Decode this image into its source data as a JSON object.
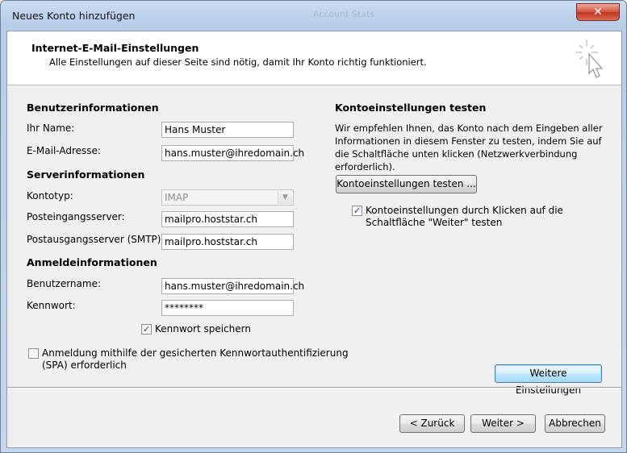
{
  "window": {
    "title": "Neues Konto hinzufügen",
    "background_title": "Account Stats",
    "close_label": "✕"
  },
  "header": {
    "title": "Internet-E-Mail-Einstellungen",
    "subtitle": "Alle Einstellungen auf dieser Seite sind nötig, damit Ihr Konto richtig funktioniert."
  },
  "user_info": {
    "heading": "Benutzerinformationen",
    "name_label": "Ihr Name:",
    "name_value": "Hans Muster",
    "email_label": "E-Mail-Adresse:",
    "email_value": "hans.muster@ihredomain.ch"
  },
  "server_info": {
    "heading": "Serverinformationen",
    "account_type_label": "Kontotyp:",
    "account_type_value": "IMAP",
    "incoming_label": "Posteingangsserver:",
    "incoming_value": "mailpro.hoststar.ch",
    "outgoing_label": "Postausgangsserver (SMTP):",
    "outgoing_value": "mailpro.hoststar.ch"
  },
  "login_info": {
    "heading": "Anmeldeinformationen",
    "username_label": "Benutzername:",
    "username_value": "hans.muster@ihredomain.ch",
    "password_label": "Kennwort:",
    "password_value": "********",
    "remember_label": "Kennwort speichern",
    "remember_checked": true,
    "spa_label_line1": "Anmeldung mithilfe der gesicherten Kennwortauthentifizierung",
    "spa_label_line2": "(SPA) erforderlich",
    "spa_checked": false
  },
  "test_settings": {
    "heading": "Kontoeinstellungen testen",
    "description": "Wir empfehlen Ihnen, das Konto nach dem Eingeben aller Informationen in diesem Fenster zu testen, indem Sie auf die Schaltfläche unten klicken (Netzwerkverbindung erforderlich).",
    "test_button": "Kontoeinstellungen testen ...",
    "auto_test_line1": "Kontoeinstellungen durch Klicken auf die",
    "auto_test_line2": "Schaltfläche \"Weiter\" testen",
    "auto_test_checked": true
  },
  "more_settings_button": "Weitere Einstellungen",
  "footer": {
    "back": "< Zurück",
    "next": "Weiter >",
    "cancel": "Abbrechen"
  },
  "checkmark": "✓",
  "dropdown_arrow": "▼",
  "icons": {
    "wizard": "wizard-sparkle-cursor-icon"
  }
}
